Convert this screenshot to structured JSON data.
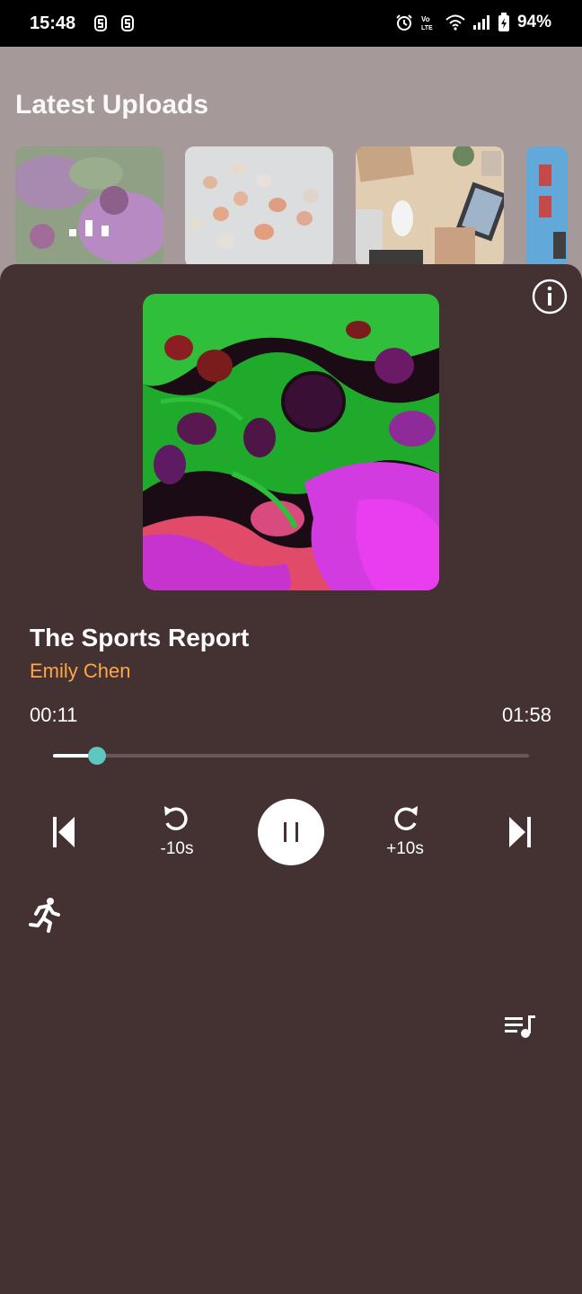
{
  "status_bar": {
    "time": "15:48",
    "battery": "94%",
    "icons": [
      "notification-s-icon",
      "notification-s-icon",
      "alarm-icon",
      "volte-icon",
      "wifi-icon",
      "signal-icon",
      "battery-charging-icon"
    ]
  },
  "background_page": {
    "section_title": "Latest Uploads",
    "thumbnails": [
      {
        "label": "marbled-art-thumbnail",
        "now_playing": true
      },
      {
        "label": "eggs-thumbnail"
      },
      {
        "label": "desk-workspace-thumbnail"
      },
      {
        "label": "blue-items-thumbnail"
      }
    ]
  },
  "player": {
    "title": "The Sports Report",
    "artist": "Emily Chen",
    "elapsed": "00:11",
    "duration": "01:58",
    "progress": 0.093,
    "rewind_label": "-10s",
    "forward_label": "+10s",
    "state": "playing",
    "colors": {
      "background": "#443131",
      "artist": "#ffa646",
      "seek_thumb": "#5ec8c0"
    }
  }
}
